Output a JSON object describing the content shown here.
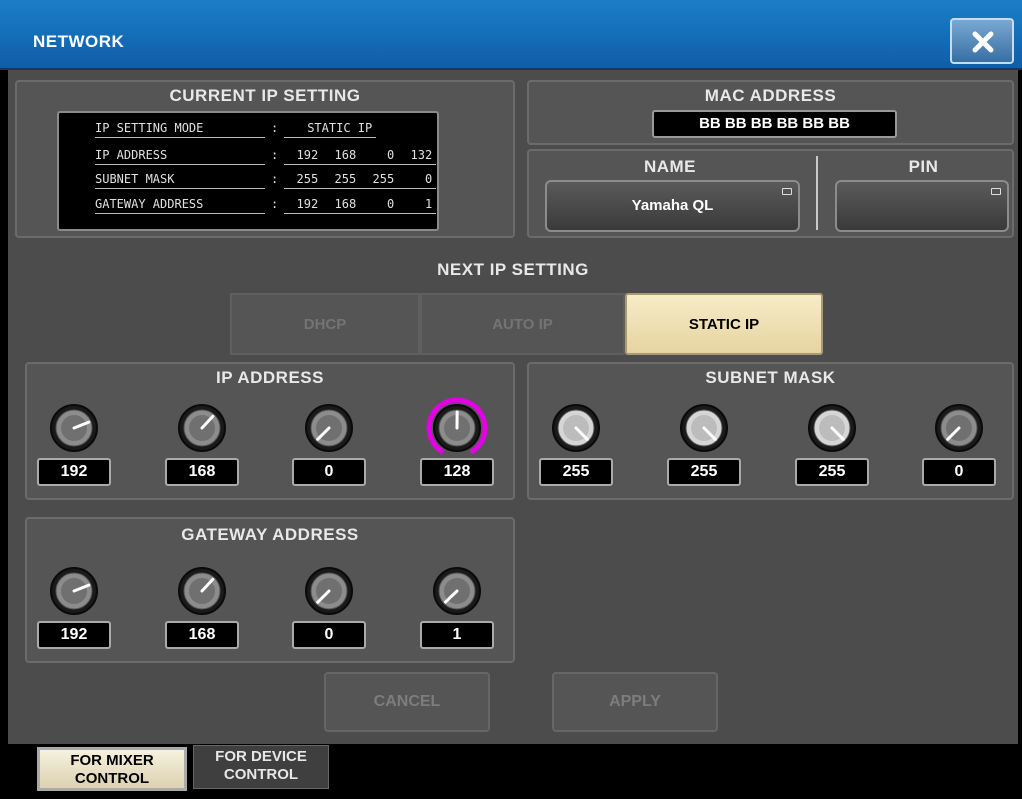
{
  "window": {
    "title": "NETWORK",
    "close_icon": "close-icon"
  },
  "current_ip": {
    "title": "CURRENT IP SETTING",
    "rows": [
      {
        "label": "IP SETTING MODE",
        "sep": ":",
        "values": [
          "STATIC IP"
        ]
      },
      {
        "label": "IP ADDRESS",
        "sep": ":",
        "values": [
          "192",
          "168",
          "0",
          "132"
        ]
      },
      {
        "label": "SUBNET MASK",
        "sep": ":",
        "values": [
          "255",
          "255",
          "255",
          "0"
        ]
      },
      {
        "label": "GATEWAY ADDRESS",
        "sep": ":",
        "values": [
          "192",
          "168",
          "0",
          "1"
        ]
      }
    ]
  },
  "mac": {
    "title": "MAC ADDRESS",
    "value": "BB BB BB BB BB BB"
  },
  "name": {
    "title": "NAME",
    "value": "Yamaha QL"
  },
  "pin": {
    "title": "PIN",
    "value": ""
  },
  "next_ip": {
    "title": "NEXT IP SETTING",
    "modes": [
      "DHCP",
      "AUTO IP",
      "STATIC IP"
    ],
    "selected": "STATIC IP"
  },
  "ip_address": {
    "title": "IP ADDRESS",
    "values": [
      192,
      168,
      0,
      128
    ],
    "highlighted_index": 3
  },
  "subnet_mask": {
    "title": "SUBNET MASK",
    "values": [
      255,
      255,
      255,
      0
    ]
  },
  "gateway": {
    "title": "GATEWAY ADDRESS",
    "values": [
      192,
      168,
      0,
      1
    ]
  },
  "actions": {
    "cancel": "CANCEL",
    "apply": "APPLY"
  },
  "tabs": [
    {
      "line1": "FOR MIXER",
      "line2": "CONTROL",
      "active": true
    },
    {
      "line1": "FOR DEVICE",
      "line2": "CONTROL",
      "active": false
    }
  ],
  "colors": {
    "titlebar": "#1477c4",
    "selected_mode": "#f2e5bd",
    "knob_highlight": "#e400e6"
  }
}
